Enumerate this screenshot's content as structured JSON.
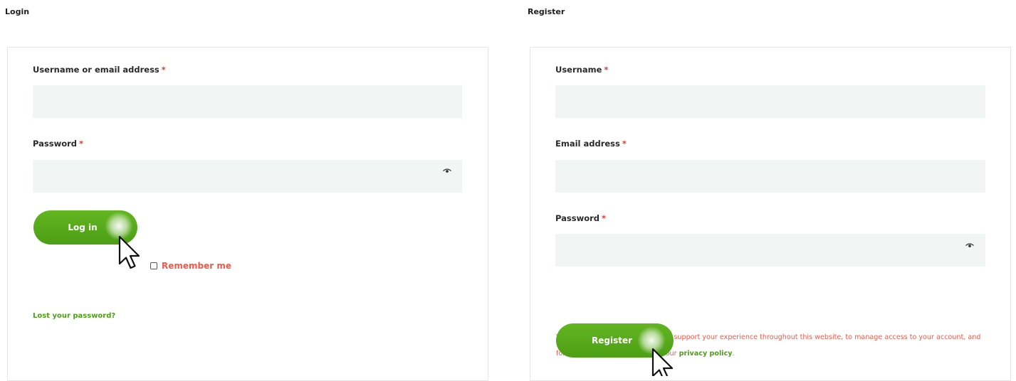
{
  "login": {
    "title": "Login",
    "username_label": "Username or email address",
    "username_value": "",
    "password_label": "Password",
    "password_value": "",
    "required_mark": "*",
    "login_button": "Log in",
    "remember_label": "Remember me",
    "lost_password": "Lost your password?"
  },
  "register": {
    "title": "Register",
    "username_label": "Username",
    "username_value": "",
    "email_label": "Email address",
    "email_value": "",
    "password_label": "Password",
    "password_value": "",
    "required_mark": "*",
    "privacy_text": "Your personal data will be used to support your experience throughout this website, to manage access to your account, and for other purposes described in our",
    "privacy_link": "privacy policy",
    "privacy_end": ".",
    "register_button": "Register"
  },
  "colors": {
    "accent_green": "#4c9f14",
    "required_red": "#e53935",
    "notice_red": "#ef5a4a",
    "input_bg": "#f1f5f3"
  },
  "icons": {
    "password_toggle": "eye-icon",
    "pointer": "mouse-cursor-icon"
  }
}
